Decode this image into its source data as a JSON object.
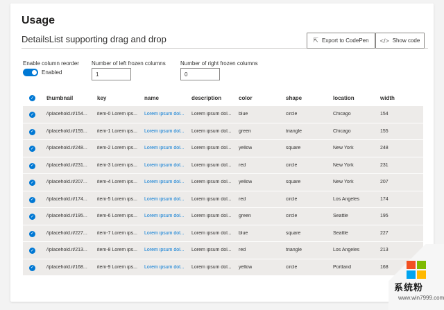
{
  "page": {
    "usage_title": "Usage",
    "section_title": "DetailsList supporting drag and drop",
    "export_button": "Export to CodePen",
    "show_code_button": "Show code"
  },
  "controls": {
    "reorder_label": "Enable column reorder",
    "reorder_state": "Enabled",
    "left_frozen_label": "Number of left frozen columns",
    "left_frozen_value": "1",
    "right_frozen_label": "Number of right frozen columns",
    "right_frozen_value": "0"
  },
  "table": {
    "columns": [
      "thumbnail",
      "key",
      "name",
      "description",
      "color",
      "shape",
      "location",
      "width"
    ],
    "rows": [
      {
        "thumbnail": "//placehold.it/154...",
        "key": "item-0 Lorem ips...",
        "name": "Lorem ipsum dol...",
        "description": "Lorem ipsum dol...",
        "color": "blue",
        "shape": "circle",
        "location": "Chicago",
        "width": "154"
      },
      {
        "thumbnail": "//placehold.it/155...",
        "key": "item-1 Lorem ips...",
        "name": "Lorem ipsum dol...",
        "description": "Lorem ipsum dol...",
        "color": "green",
        "shape": "triangle",
        "location": "Chicago",
        "width": "155"
      },
      {
        "thumbnail": "//placehold.it/248...",
        "key": "item-2 Lorem ips...",
        "name": "Lorem ipsum dol...",
        "description": "Lorem ipsum dol...",
        "color": "yellow",
        "shape": "square",
        "location": "New York",
        "width": "248"
      },
      {
        "thumbnail": "//placehold.it/231...",
        "key": "item-3 Lorem ips...",
        "name": "Lorem ipsum dol...",
        "description": "Lorem ipsum dol...",
        "color": "red",
        "shape": "circle",
        "location": "New York",
        "width": "231"
      },
      {
        "thumbnail": "//placehold.it/207...",
        "key": "item-4 Lorem ips...",
        "name": "Lorem ipsum dol...",
        "description": "Lorem ipsum dol...",
        "color": "yellow",
        "shape": "square",
        "location": "New York",
        "width": "207"
      },
      {
        "thumbnail": "//placehold.it/174...",
        "key": "item-5 Lorem ips...",
        "name": "Lorem ipsum dol...",
        "description": "Lorem ipsum dol...",
        "color": "red",
        "shape": "circle",
        "location": "Los Angeles",
        "width": "174"
      },
      {
        "thumbnail": "//placehold.it/195...",
        "key": "item-6 Lorem ips...",
        "name": "Lorem ipsum dol...",
        "description": "Lorem ipsum dol...",
        "color": "green",
        "shape": "circle",
        "location": "Seattle",
        "width": "195"
      },
      {
        "thumbnail": "//placehold.it/227...",
        "key": "item-7 Lorem ips...",
        "name": "Lorem ipsum dol...",
        "description": "Lorem ipsum dol...",
        "color": "blue",
        "shape": "square",
        "location": "Seattle",
        "width": "227"
      },
      {
        "thumbnail": "//placehold.it/213...",
        "key": "item-8 Lorem ips...",
        "name": "Lorem ipsum dol...",
        "description": "Lorem ipsum dol...",
        "color": "red",
        "shape": "triangle",
        "location": "Los Angeles",
        "width": "213"
      },
      {
        "thumbnail": "//placehold.it/168...",
        "key": "item-9 Lorem ips...",
        "name": "Lorem ipsum dol...",
        "description": "Lorem ipsum dol...",
        "color": "yellow",
        "shape": "circle",
        "location": "Portland",
        "width": "168"
      }
    ]
  },
  "watermark": {
    "text": "系统粉",
    "url": "www.win7999.com"
  },
  "icons": {
    "export": "external-link-icon",
    "code": "code-icon",
    "check": "checkmark-icon"
  },
  "colors": {
    "accent": "#0078d4",
    "row_bg": "#edebe9",
    "logo": [
      "#f25022",
      "#7fba00",
      "#00a4ef",
      "#ffb900"
    ]
  }
}
